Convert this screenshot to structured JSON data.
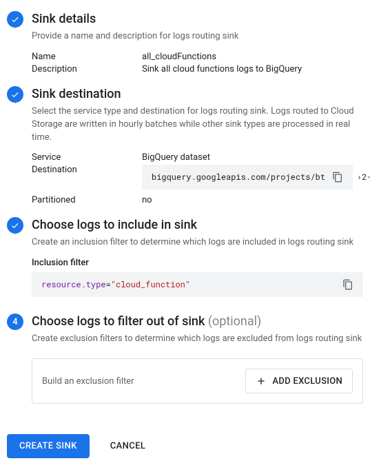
{
  "steps": {
    "details": {
      "title": "Sink details",
      "help": "Provide a name and description for logs routing sink",
      "name_label": "Name",
      "name_value": "all_cloudFunctions",
      "desc_label": "Description",
      "desc_value": "Sink all cloud functions logs to BigQuery"
    },
    "destination": {
      "title": "Sink destination",
      "help": "Select the service type and destination for logs routing sink. Logs routed to Cloud Storage are written in hourly batches while other sink types are processed in real time.",
      "service_label": "Service",
      "service_value": "BigQuery dataset",
      "dest_label": "Destination",
      "dest_value": "bigquery.googleapis.com/projects/bt",
      "dest_tail": "›2-",
      "partitioned_label": "Partitioned",
      "partitioned_value": "no"
    },
    "include": {
      "title": "Choose logs to include in sink",
      "help": "Create an inclusion filter to determine which logs are included in logs routing sink",
      "filter_label": "Inclusion filter",
      "filter_kw": "resource.type",
      "filter_eq": "=",
      "filter_str": "\"cloud_function\""
    },
    "exclude": {
      "number": "4",
      "title": "Choose logs to filter out of sink",
      "optional": "(optional)",
      "help": "Create exclusion filters to determine which logs are excluded from logs routing sink",
      "hint": "Build an exclusion filter",
      "add_label": "ADD EXCLUSION"
    }
  },
  "actions": {
    "create": "CREATE SINK",
    "cancel": "CANCEL"
  }
}
